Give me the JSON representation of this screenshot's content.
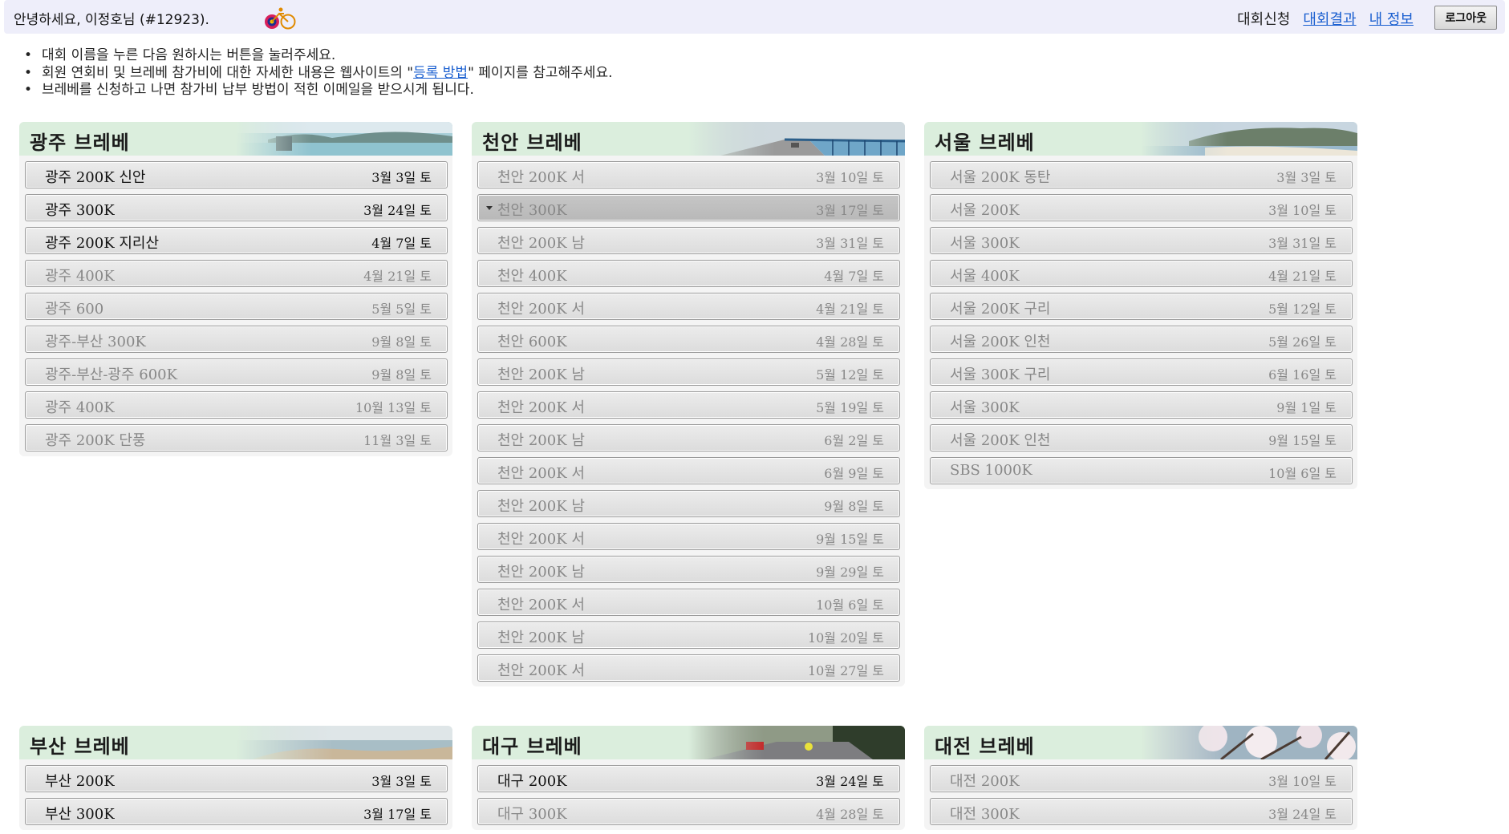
{
  "header": {
    "greeting": "안녕하세요, 이정호님 (#12923).",
    "nav": {
      "apply": "대회신청",
      "results": "대회결과",
      "my_info": "내 정보"
    },
    "logout_label": "로그아웃"
  },
  "notes": [
    "대회 이름을 누른 다음 원하시는 버튼을 눌러주세요.",
    {
      "before": "회원 연회비 및 브레베 참가비에 대한 자세한 내용은 웹사이트의 \"",
      "link": "등록 방법",
      "after": "\" 페이지를 참고해주세요."
    },
    "브레베를 신청하고 나면 참가비 납부 방법이 적힌 이메일을 받으시게 됩니다."
  ],
  "colors": {
    "link": "#1a5fd0",
    "panel_header": "#dbeedd",
    "active_text": "#111111",
    "inactive_text": "#888888"
  },
  "regions": [
    {
      "title": "광주 브레베",
      "scene": "harbor",
      "events": [
        {
          "name": "광주 200K 신안",
          "date": "3월 3일 토",
          "active": true
        },
        {
          "name": "광주 300K",
          "date": "3월 24일 토",
          "active": true
        },
        {
          "name": "광주 200K 지리산",
          "date": "4월 7일 토",
          "active": true
        },
        {
          "name": "광주 400K",
          "date": "4월 21일 토",
          "active": false
        },
        {
          "name": "광주 600",
          "date": "5월 5일 토",
          "active": false
        },
        {
          "name": "광주-부산 300K",
          "date": "9월 8일 토",
          "active": false
        },
        {
          "name": "광주-부산-광주 600K",
          "date": "9월 8일 토",
          "active": false
        },
        {
          "name": "광주 400K",
          "date": "10월 13일 토",
          "active": false
        },
        {
          "name": "광주 200K 단풍",
          "date": "11월 3일 토",
          "active": false
        }
      ]
    },
    {
      "title": "천안 브레베",
      "scene": "bridge",
      "events": [
        {
          "name": "천안 200K 서",
          "date": "3월 10일 토",
          "active": false
        },
        {
          "name": "천안 300K",
          "date": "3월 17일 토",
          "active": false,
          "selected": true
        },
        {
          "name": "천안 200K 남",
          "date": "3월 31일 토",
          "active": false
        },
        {
          "name": "천안 400K",
          "date": "4월 7일 토",
          "active": false
        },
        {
          "name": "천안 200K 서",
          "date": "4월 21일 토",
          "active": false
        },
        {
          "name": "천안 600K",
          "date": "4월 28일 토",
          "active": false
        },
        {
          "name": "천안 200K 남",
          "date": "5월 12일 토",
          "active": false
        },
        {
          "name": "천안 200K 서",
          "date": "5월 19일 토",
          "active": false
        },
        {
          "name": "천안 200K 남",
          "date": "6월 2일 토",
          "active": false
        },
        {
          "name": "천안 200K 서",
          "date": "6월 9일 토",
          "active": false
        },
        {
          "name": "천안 200K 남",
          "date": "9월 8일 토",
          "active": false
        },
        {
          "name": "천안 200K 서",
          "date": "9월 15일 토",
          "active": false
        },
        {
          "name": "천안 200K 남",
          "date": "9월 29일 토",
          "active": false
        },
        {
          "name": "천안 200K 서",
          "date": "10월 6일 토",
          "active": false
        },
        {
          "name": "천안 200K 남",
          "date": "10월 20일 토",
          "active": false
        },
        {
          "name": "천안 200K 서",
          "date": "10월 27일 토",
          "active": false
        }
      ]
    },
    {
      "title": "서울 브레베",
      "scene": "coast",
      "events": [
        {
          "name": "서울 200K 동탄",
          "date": "3월 3일 토",
          "active": false
        },
        {
          "name": "서울 200K",
          "date": "3월 10일 토",
          "active": false
        },
        {
          "name": "서울 300K",
          "date": "3월 31일 토",
          "active": false
        },
        {
          "name": "서울 400K",
          "date": "4월 21일 토",
          "active": false
        },
        {
          "name": "서울 200K 구리",
          "date": "5월 12일 토",
          "active": false
        },
        {
          "name": "서울 200K 인천",
          "date": "5월 26일 토",
          "active": false
        },
        {
          "name": "서울 300K 구리",
          "date": "6월 16일 토",
          "active": false
        },
        {
          "name": "서울 300K",
          "date": "9월 1일 토",
          "active": false
        },
        {
          "name": "서울 200K 인천",
          "date": "9월 15일 토",
          "active": false
        },
        {
          "name": "SBS 1000K",
          "date": "10월 6일 토",
          "active": false
        }
      ]
    },
    {
      "title": "부산 브레베",
      "scene": "beach",
      "events": [
        {
          "name": "부산 200K",
          "date": "3월 3일 토",
          "active": true
        },
        {
          "name": "부산 300K",
          "date": "3월 17일 토",
          "active": true
        }
      ]
    },
    {
      "title": "대구 브레베",
      "scene": "road",
      "events": [
        {
          "name": "대구 200K",
          "date": "3월 24일 토",
          "active": true
        },
        {
          "name": "대구 300K",
          "date": "4월 28일 토",
          "active": false
        }
      ]
    },
    {
      "title": "대전 브레베",
      "scene": "blossom",
      "events": [
        {
          "name": "대전 200K",
          "date": "3월 10일 토",
          "active": false
        },
        {
          "name": "대전 300K",
          "date": "3월 24일 토",
          "active": false
        }
      ]
    }
  ]
}
